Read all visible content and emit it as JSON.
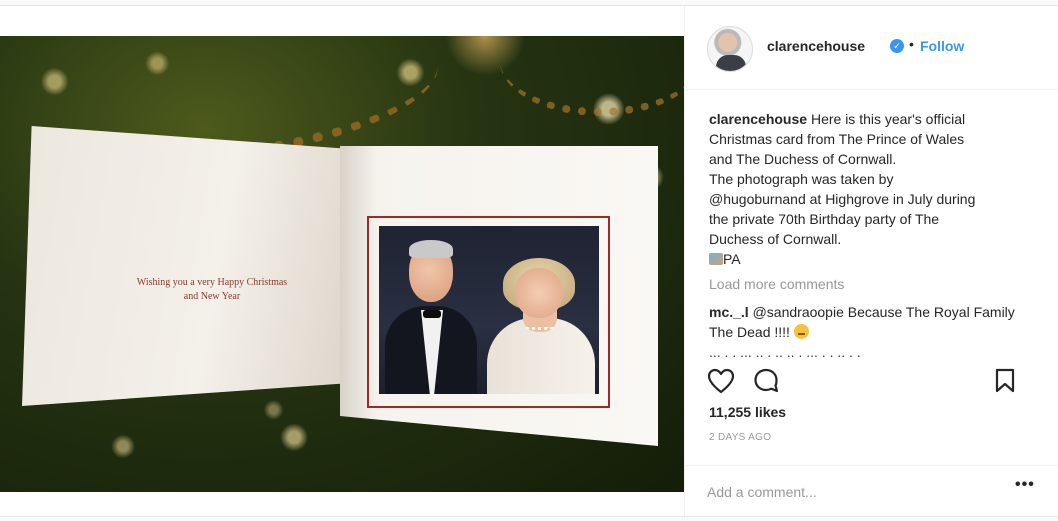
{
  "post": {
    "username": "clarencehouse",
    "separator": "•",
    "follow_label": "Follow",
    "verified_mark": "✓",
    "caption_lines": [
      "Here is this year's official",
      "Christmas card from The Prince of Wales",
      "and The Duchess of Cornwall.",
      "The photograph was taken by",
      "@hugoburnand at Highgrove in July during",
      "the private 70th Birthday party of The",
      "Duchess of Cornwall.",
      "PA"
    ],
    "load_more_label": "Load more comments",
    "comments": [
      {
        "user": "mc._.l",
        "text": "@sandraoopie Because The Royal Family The Dead !!!!"
      }
    ],
    "cut_off_text": "... . . ... .. . .. .. . ... . . .. . .",
    "likes": "11,255 likes",
    "time": "2 DAYS AGO",
    "add_comment_placeholder": "Add a comment...",
    "more_label": "•••"
  },
  "card": {
    "greeting_line1": "Wishing you a very Happy Christmas",
    "greeting_line2": "and New Year"
  },
  "icons": {
    "like": "heart-icon",
    "comment": "comment-bubble-icon",
    "save": "bookmark-icon",
    "verified": "verified-badge-icon"
  },
  "colors": {
    "link_blue": "#3897f0",
    "text": "#262626",
    "muted": "#999999",
    "card_accent": "#9d2a26"
  }
}
